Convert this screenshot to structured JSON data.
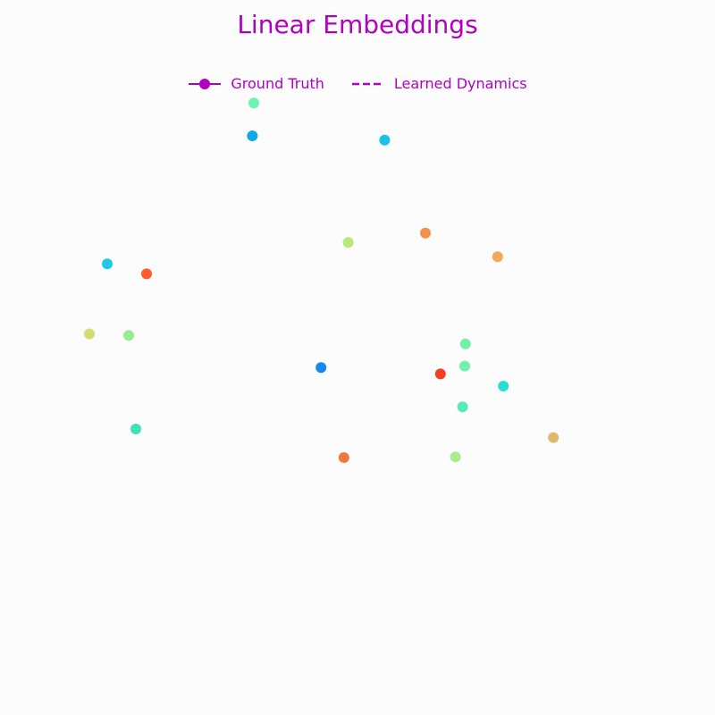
{
  "colors": {
    "accent": "#b000c0",
    "background": "#fcfcfc"
  },
  "chart_data": {
    "type": "scatter",
    "title": "Linear Embeddings",
    "xlabel": "",
    "ylabel": "",
    "axes_visible": false,
    "grid": false,
    "legend_placement": "top-center",
    "legend": [
      {
        "label": "Ground Truth",
        "style": "solid line with circle marker"
      },
      {
        "label": "Learned Dynamics",
        "style": "dashed line"
      }
    ],
    "xlim": [
      0,
      100
    ],
    "ylim": [
      0,
      100
    ],
    "points": [
      {
        "x": 35.5,
        "y": 85.6,
        "color": "#6cf5b0"
      },
      {
        "x": 35.3,
        "y": 81.0,
        "color": "#10a8e8"
      },
      {
        "x": 53.8,
        "y": 80.4,
        "color": "#18c2e8"
      },
      {
        "x": 48.7,
        "y": 66.1,
        "color": "#b8e878"
      },
      {
        "x": 59.5,
        "y": 67.4,
        "color": "#f4904c"
      },
      {
        "x": 69.6,
        "y": 64.1,
        "color": "#f6a85a"
      },
      {
        "x": 15.0,
        "y": 63.1,
        "color": "#20c8e4"
      },
      {
        "x": 20.5,
        "y": 61.7,
        "color": "#ff5a30"
      },
      {
        "x": 12.5,
        "y": 53.3,
        "color": "#d4dc74"
      },
      {
        "x": 18.0,
        "y": 53.1,
        "color": "#98ec90"
      },
      {
        "x": 65.1,
        "y": 51.9,
        "color": "#70f0a8"
      },
      {
        "x": 44.9,
        "y": 48.6,
        "color": "#1488ec"
      },
      {
        "x": 65.0,
        "y": 48.8,
        "color": "#70f0a8"
      },
      {
        "x": 61.6,
        "y": 47.7,
        "color": "#f24020"
      },
      {
        "x": 70.4,
        "y": 46.0,
        "color": "#2cdcd0"
      },
      {
        "x": 64.7,
        "y": 43.1,
        "color": "#58eab4"
      },
      {
        "x": 19.0,
        "y": 40.0,
        "color": "#40e0b8"
      },
      {
        "x": 77.4,
        "y": 38.8,
        "color": "#e0b86c"
      },
      {
        "x": 48.1,
        "y": 36.0,
        "color": "#f07838"
      },
      {
        "x": 63.7,
        "y": 36.1,
        "color": "#a8ec8c"
      }
    ]
  }
}
